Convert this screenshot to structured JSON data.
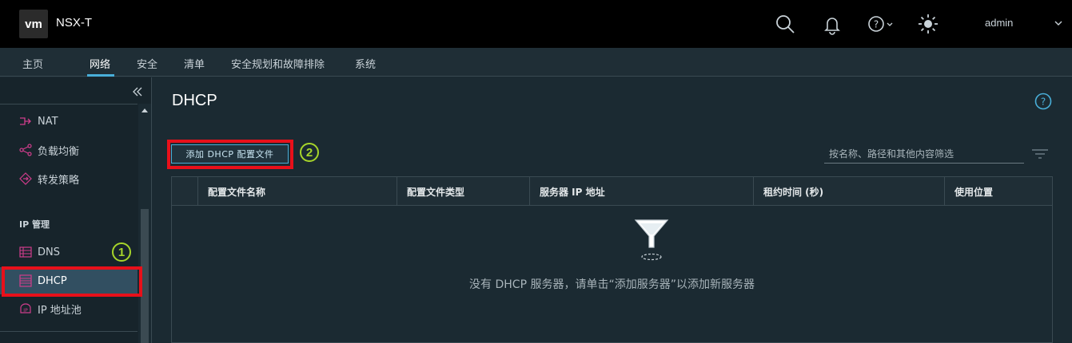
{
  "header": {
    "logo": "vm",
    "app_title": "NSX-T",
    "icons": [
      "search-icon",
      "bell-icon",
      "help-icon",
      "sun-icon"
    ],
    "user": "admin"
  },
  "nav": {
    "tabs": [
      {
        "label": "主页"
      },
      {
        "label": "网络",
        "active": true
      },
      {
        "label": "安全"
      },
      {
        "label": "清单"
      },
      {
        "label": "安全规划和故障排除"
      },
      {
        "label": "系统"
      }
    ]
  },
  "sidebar": {
    "items": [
      {
        "label": "NAT",
        "icon": "nat-icon"
      },
      {
        "label": "负载均衡",
        "icon": "load-balancer-icon"
      },
      {
        "label": "转发策略",
        "icon": "forwarding-policy-icon"
      }
    ],
    "section_title": "IP 管理",
    "ip_items": [
      {
        "label": "DNS",
        "icon": "dns-icon"
      },
      {
        "label": "DHCP",
        "icon": "dhcp-icon",
        "selected": true
      },
      {
        "label": "IP 地址池",
        "icon": "ip-pool-icon"
      }
    ]
  },
  "annotations": {
    "step1": "1",
    "step2": "2",
    "highlight_color": "#e8101a",
    "marker_color": "#a7d52a"
  },
  "main": {
    "title": "DHCP",
    "add_button": "添加 DHCP 配置文件",
    "filter_placeholder": "按名称、路径和其他内容筛选",
    "columns": [
      "配置文件名称",
      "配置文件类型",
      "服务器 IP 地址",
      "租约时间 (秒)",
      "使用位置"
    ],
    "empty_message": "没有 DHCP 服务器，请单击“添加服务器”以添加新服务器"
  },
  "colors": {
    "accent": "#49afd9",
    "header_bg": "#000000",
    "page_bg": "#1b2a32"
  }
}
